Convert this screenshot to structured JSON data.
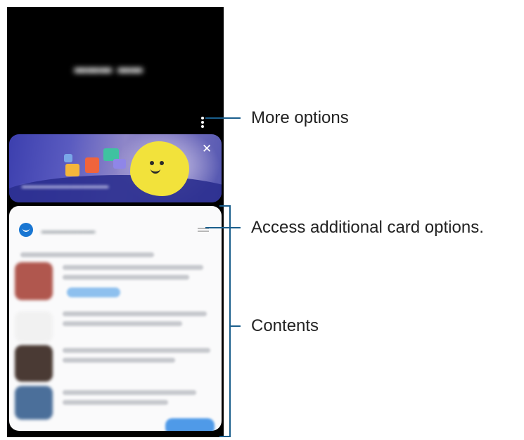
{
  "annotations": {
    "more_options": "More options",
    "card_options": "Access additional card options.",
    "contents": "Contents"
  },
  "icons": {
    "more_options": "vertical-dots-icon",
    "close": "close-icon",
    "card_options": "hamburger-icon",
    "app_logo": "smile-logo-icon"
  },
  "colors": {
    "annotation_line": "#1a5e8c",
    "banner_blue": "#3c3fae",
    "sun_yellow": "#f2e23b",
    "logo_blue": "#1976d2"
  }
}
